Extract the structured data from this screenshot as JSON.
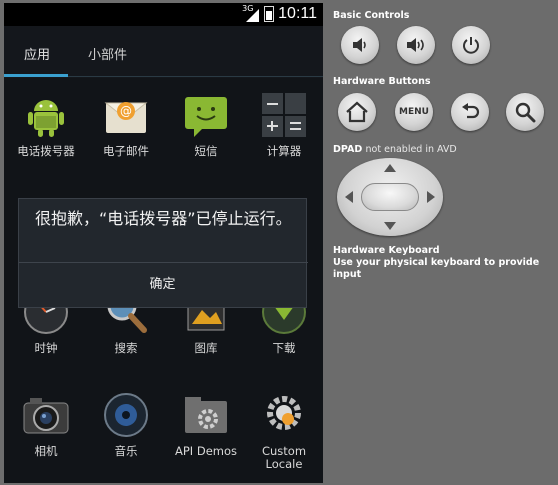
{
  "status_bar": {
    "network": "3G",
    "time": "10:11"
  },
  "tabs": [
    {
      "label": "应用"
    },
    {
      "label": "小部件"
    }
  ],
  "apps": [
    {
      "label": "电话拨号器",
      "icon": "android-icon"
    },
    {
      "label": "电子邮件",
      "icon": "email-icon"
    },
    {
      "label": "短信",
      "icon": "messaging-icon"
    },
    {
      "label": "计算器",
      "icon": "calculator-icon"
    },
    {
      "label": "时钟",
      "icon": "clock-icon"
    },
    {
      "label": "搜索",
      "icon": "search-icon"
    },
    {
      "label": "图库",
      "icon": "gallery-icon"
    },
    {
      "label": "下载",
      "icon": "download-icon"
    },
    {
      "label": "相机",
      "icon": "camera-icon"
    },
    {
      "label": "音乐",
      "icon": "music-icon"
    },
    {
      "label": "API Demos",
      "icon": "folder-gear-icon"
    },
    {
      "label": "Custom Locale",
      "icon": "locale-gear-icon"
    }
  ],
  "dialog": {
    "message": "很抱歉，“电话拨号器”已停止运行。",
    "button": "确定"
  },
  "controls": {
    "basic_title": "Basic Controls",
    "hardware_title": "Hardware Buttons",
    "menu_label": "MENU",
    "dpad_title": "DPAD",
    "dpad_note": "not enabled in AVD",
    "keyboard_title": "Hardware Keyboard",
    "keyboard_note": "Use your physical keyboard to provide input"
  },
  "colors": {
    "accent": "#3aa0cf",
    "dialog_bg": "#22272d",
    "panel_bg": "#6c6c6c"
  }
}
